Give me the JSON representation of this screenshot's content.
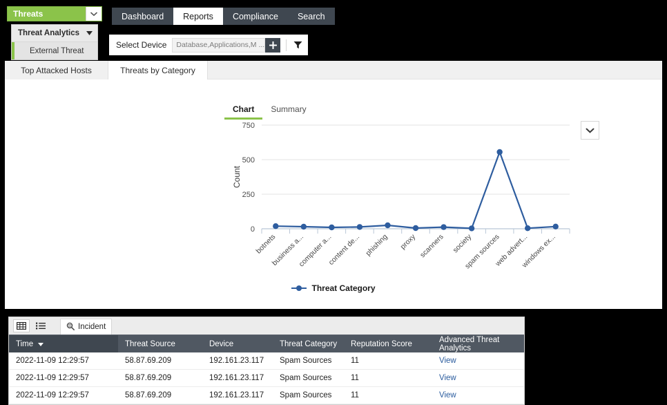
{
  "module_select": {
    "value": "Threats",
    "caret_icon": "chevron-down-icon",
    "accent_color": "#8bc34a"
  },
  "submenu": {
    "header": "Threat Analytics",
    "header_caret_icon": "caret-down-icon",
    "items": [
      {
        "label": "External Threat",
        "selected": true
      }
    ]
  },
  "nav": {
    "tabs": [
      {
        "label": "Dashboard",
        "active": false
      },
      {
        "label": "Reports",
        "active": true
      },
      {
        "label": "Compliance",
        "active": false
      },
      {
        "label": "Search",
        "active": false
      }
    ]
  },
  "device_bar": {
    "label": "Select Device",
    "value": "Database,Applications,M  ...",
    "placeholder": "Select Device",
    "add_icon": "plus-icon",
    "filter_icon": "funnel-icon"
  },
  "report_tabs": [
    {
      "label": "Top Attacked Hosts",
      "active": false
    },
    {
      "label": "Threats by Category",
      "active": true
    }
  ],
  "chart_panel": {
    "subtabs": [
      {
        "label": "Chart",
        "active": true
      },
      {
        "label": "Summary",
        "active": false
      }
    ],
    "expand_icon": "chevron-down-icon",
    "accent_color": "#8bc34a"
  },
  "chart_data": {
    "type": "line",
    "title": "",
    "xlabel": "",
    "ylabel": "Count",
    "ylim": [
      0,
      750
    ],
    "yticks": [
      0,
      250,
      500,
      750
    ],
    "grid": true,
    "legend_position": "bottom",
    "line_color": "#2e5d9f",
    "categories": [
      "botnets",
      "business a...",
      "computer a...",
      "content de...",
      "phishing",
      "proxy",
      "scanners",
      "society",
      "spam sources",
      "web advert...",
      "windows ex..."
    ],
    "series": [
      {
        "name": "Threat Category",
        "values": [
          19,
          15,
          10,
          13,
          25,
          5,
          12,
          3,
          555,
          4,
          16
        ]
      }
    ]
  },
  "table_panel": {
    "toolbar": {
      "grid_view_icon": "grid-view-icon",
      "list_view_icon": "list-view-icon",
      "incident_icon": "incident-search-icon",
      "incident_label": "Incident"
    },
    "columns": [
      "Time",
      "Threat Source",
      "Device",
      "Threat Category",
      "Reputation Score",
      "Advanced Threat Analytics"
    ],
    "sort_icon": "sort-descending-icon",
    "rows": [
      {
        "time": "2022-11-09 12:29:57",
        "threat_source": "58.87.69.209",
        "device": "192.161.23.117",
        "threat_category": "Spam Sources",
        "reputation_score": "11",
        "advanced_threat_analytics": "View"
      },
      {
        "time": "2022-11-09 12:29:57",
        "threat_source": "58.87.69.209",
        "device": "192.161.23.117",
        "threat_category": "Spam Sources",
        "reputation_score": "11",
        "advanced_threat_analytics": "View"
      },
      {
        "time": "2022-11-09 12:29:57",
        "threat_source": "58.87.69.209",
        "device": "192.161.23.117",
        "threat_category": "Spam Sources",
        "reputation_score": "11",
        "advanced_threat_analytics": "View"
      }
    ]
  }
}
